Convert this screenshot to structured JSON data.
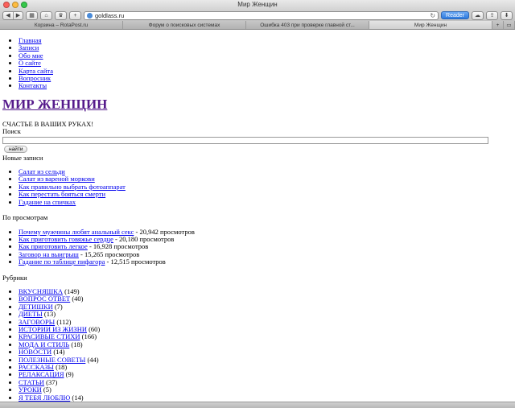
{
  "window": {
    "title": "Мир Женщин"
  },
  "toolbar": {
    "back_icon": "back-arrow-icon",
    "forward_icon": "forward-arrow-icon",
    "url": "goldlass.ru",
    "reader_label": "Reader"
  },
  "tabs": [
    {
      "label": "Корзина – RotaPost.ru"
    },
    {
      "label": "Форум о поисковых системах"
    },
    {
      "label": "Ошибка 403 при проверке главной ст..."
    },
    {
      "label": "Мир Женщин"
    }
  ],
  "nav": [
    {
      "label": "Главная"
    },
    {
      "label": "Записи"
    },
    {
      "label": "Обо мне"
    },
    {
      "label": "О сайте"
    },
    {
      "label": "Карта сайта"
    },
    {
      "label": "Вопросник"
    },
    {
      "label": "Контакты"
    }
  ],
  "site": {
    "title": "МИР ЖЕНЩИН",
    "tagline": "СЧАСТЬЕ В ВАШИХ РУКАХ!"
  },
  "search": {
    "label": "Поиск",
    "value": "",
    "button_label": "найти"
  },
  "new_posts": {
    "title": "Новые записи",
    "items": [
      {
        "label": "Салат из сельди"
      },
      {
        "label": "Салат из вареной моркови"
      },
      {
        "label": "Как правильно выбрать фотоаппарат"
      },
      {
        "label": "Как перестать бояться смерти"
      },
      {
        "label": "Гадание на спичках"
      }
    ]
  },
  "popular": {
    "title": "По просмотрам",
    "items": [
      {
        "label": "Почему мужчины любят анальный секс",
        "count": " - 20,942 просмотров"
      },
      {
        "label": "Как приготовить говяжье сердце",
        "count": " - 20,180 просмотров"
      },
      {
        "label": "Как приготовить легкое",
        "count": " - 16,928 просмотров"
      },
      {
        "label": "Заговор на выигрыш",
        "count": " - 15,265 просмотров"
      },
      {
        "label": "Гадание по таблице пифагора",
        "count": " - 12,515 просмотров"
      }
    ]
  },
  "categories": {
    "title": "Рубрики",
    "items": [
      {
        "label": "ВКУСНЯШКА",
        "count": " (149)"
      },
      {
        "label": "ВОПРОС ОТВЕТ",
        "count": " (40)"
      },
      {
        "label": "ДЕТИШКИ",
        "count": " (7)"
      },
      {
        "label": "ДИЕТЫ",
        "count": " (13)"
      },
      {
        "label": "ЗАГОВОРЫ",
        "count": " (112)"
      },
      {
        "label": "ИСТОРИИ ИЗ ЖИЗНИ",
        "count": " (60)"
      },
      {
        "label": "КРАСИВЫЕ СТИХИ",
        "count": " (166)"
      },
      {
        "label": "МОДА И СТИЛЬ",
        "count": " (18)"
      },
      {
        "label": "НОВОСТИ",
        "count": " (14)"
      },
      {
        "label": "ПОЛЕЗНЫЕ СОВЕТЫ",
        "count": " (44)"
      },
      {
        "label": "РАССКАЗЫ",
        "count": " (18)"
      },
      {
        "label": "РЕЛАКСАЦИЯ",
        "count": " (9)"
      },
      {
        "label": "СТАТЬИ",
        "count": " (37)"
      },
      {
        "label": "УРОКИ",
        "count": " (5)"
      },
      {
        "label": "Я ТЕБЯ ЛЮБЛЮ",
        "count": " (14)"
      }
    ]
  },
  "colors": {
    "link": "#0000ee",
    "visited": "#551a8b",
    "reader": "#2c79de"
  }
}
